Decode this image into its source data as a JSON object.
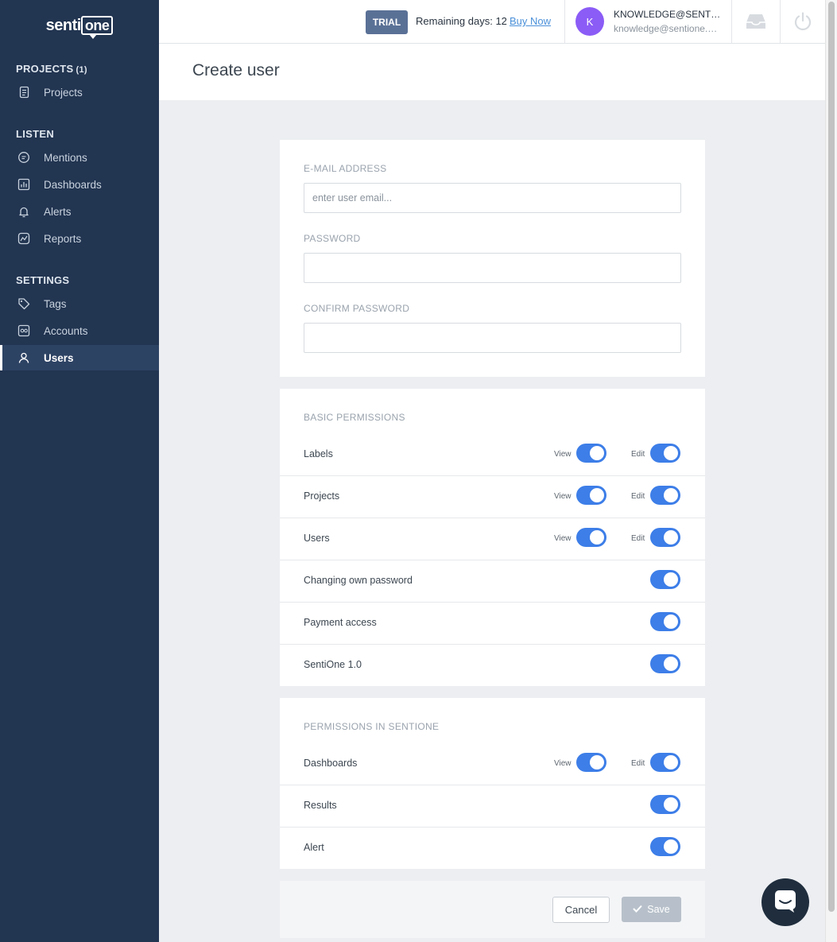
{
  "brand": {
    "logo_text": "senti",
    "logo_bubble": "one"
  },
  "sidebar": {
    "projects_title": "PROJECTS",
    "projects_count": "(1)",
    "listen_title": "LISTEN",
    "settings_title": "SETTINGS",
    "items": [
      {
        "label": "Projects",
        "icon": "document-icon"
      },
      {
        "label": "Mentions",
        "icon": "chat-icon"
      },
      {
        "label": "Dashboards",
        "icon": "bar-chart-icon"
      },
      {
        "label": "Alerts",
        "icon": "bell-icon"
      },
      {
        "label": "Reports",
        "icon": "report-icon"
      },
      {
        "label": "Tags",
        "icon": "tag-icon"
      },
      {
        "label": "Accounts",
        "icon": "accounts-icon"
      },
      {
        "label": "Users",
        "icon": "user-icon",
        "active": true
      }
    ]
  },
  "topbar": {
    "trial_badge": "TRIAL",
    "remaining_text": "Remaining days: 12",
    "buy_now": "Buy Now",
    "avatar_letter": "K",
    "user_name": "KNOWLEDGE@SENTIONE.COM",
    "user_email": "knowledge@sentione.com"
  },
  "page": {
    "title": "Create user"
  },
  "form": {
    "email_label": "E-MAIL ADDRESS",
    "email_placeholder": "enter user email...",
    "password_label": "PASSWORD",
    "confirm_label": "CONFIRM PASSWORD"
  },
  "basic_permissions": {
    "title": "BASIC PERMISSIONS",
    "view_label": "View",
    "edit_label": "Edit",
    "rows": [
      {
        "name": "Labels",
        "view": true,
        "edit": true
      },
      {
        "name": "Projects",
        "view": true,
        "edit": true
      },
      {
        "name": "Users",
        "view": true,
        "edit": true
      },
      {
        "name": "Changing own password",
        "enabled": true
      },
      {
        "name": "Payment access",
        "enabled": true
      },
      {
        "name": "SentiOne 1.0",
        "enabled": true
      }
    ]
  },
  "sentione_permissions": {
    "title": "PERMISSIONS IN SENTIONE",
    "rows": [
      {
        "name": "Dashboards",
        "view": true,
        "edit": true
      },
      {
        "name": "Results",
        "enabled": true
      },
      {
        "name": "Alert",
        "enabled": true
      }
    ]
  },
  "footer": {
    "cancel": "Cancel",
    "save": "Save"
  },
  "colors": {
    "sidebar": "#223551",
    "accent": "#3d7ee8",
    "trial": "#5a7196",
    "avatar": "#8b5cf6"
  }
}
